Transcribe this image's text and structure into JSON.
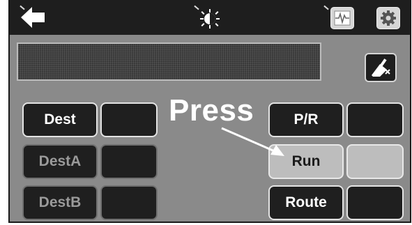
{
  "toolbar": {
    "back_icon": "back-arrow-icon",
    "brightness_icon": "brightness-icon",
    "waveform_icon": "waveform-icon",
    "settings_icon": "gear-icon"
  },
  "display": {
    "clear_icon": "eraser-icon"
  },
  "left_column": [
    {
      "label": "Dest",
      "state": "enabled",
      "value": ""
    },
    {
      "label": "DestA",
      "state": "disabled",
      "value": ""
    },
    {
      "label": "DestB",
      "state": "disabled",
      "value": ""
    }
  ],
  "right_column": [
    {
      "label": "P/R",
      "state": "enabled",
      "value": ""
    },
    {
      "label": "Run",
      "state": "pressed",
      "value": ""
    },
    {
      "label": "Route",
      "state": "enabled",
      "value": ""
    }
  ],
  "annotation": {
    "text": "Press"
  },
  "colors": {
    "panel": "#8a8a8a",
    "topbar": "#1e1e1e",
    "button": "#1f1f1f",
    "button_pressed": "#bdbdbd"
  }
}
